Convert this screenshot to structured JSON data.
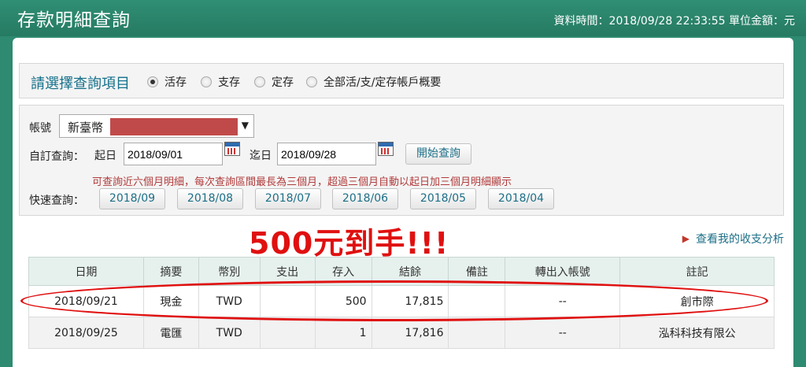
{
  "header": {
    "title": "存款明細查詢",
    "meta": "資料時間：2018/09/28 22:33:55 單位金額：元"
  },
  "select_section": {
    "heading": "請選擇查詢項目",
    "options": [
      {
        "label": "活存",
        "selected": true
      },
      {
        "label": "支存",
        "selected": false
      },
      {
        "label": "定存",
        "selected": false
      },
      {
        "label": "全部活/支/定存帳戶概要",
        "selected": false
      }
    ]
  },
  "query": {
    "account_label": "帳號",
    "account_value": "新臺幣",
    "custom_label": "自訂查詢：",
    "start_label": "起日",
    "start_date": "2018/09/01",
    "end_label": "迄日",
    "end_date": "2018/09/28",
    "search_button": "開始查詢",
    "hint": "可查詢近六個月明細，每次查詢區間最長為三個月，超過三個月自動以起日加三個月明細顯示",
    "quick_label": "快速查詢：",
    "quick_months": [
      "2018/09",
      "2018/08",
      "2018/07",
      "2018/06",
      "2018/05",
      "2018/04"
    ]
  },
  "promo_text": "500元到手!!!",
  "analysis_link": "查看我的收支分析",
  "table": {
    "columns": [
      "日期",
      "摘要",
      "幣別",
      "支出",
      "存入",
      "結餘",
      "備註",
      "轉出入帳號",
      "註記"
    ],
    "rows": [
      [
        "2018/09/21",
        "現金",
        "TWD",
        "",
        "500",
        "17,815",
        "",
        "--",
        "創市際"
      ],
      [
        "2018/09/25",
        "電匯",
        "TWD",
        "",
        "1",
        "17,816",
        "",
        "--",
        "泓科科技有限公"
      ]
    ]
  },
  "colors": {
    "header_bg": "#2e8a70",
    "accent_text": "#1d6f87",
    "promo": "#e01010",
    "hint": "#b13a3a"
  }
}
